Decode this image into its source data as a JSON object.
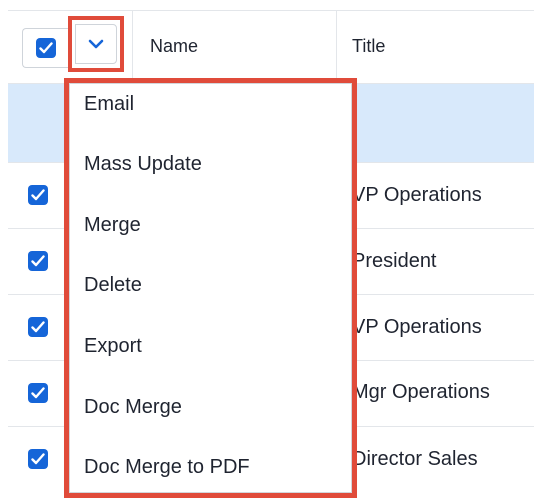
{
  "header": {
    "name_label": "Name",
    "title_label": "Title"
  },
  "icons": {
    "select_all_checkbox": "checkmark-icon",
    "actions_dropdown": "chevron-down-icon"
  },
  "colors": {
    "accent": "#1565d8",
    "annotation": "#e04b3a",
    "selected_row": "#d8e9fb"
  },
  "rows": [
    {
      "title": "",
      "checked": false,
      "highlighted": true
    },
    {
      "title": "VP Operations",
      "checked": true
    },
    {
      "title": "President",
      "checked": true
    },
    {
      "title": "VP Operations",
      "checked": true
    },
    {
      "title": "Mgr Operations",
      "checked": true
    },
    {
      "title": "Director Sales",
      "checked": true
    }
  ],
  "menu": {
    "items": [
      "Email",
      "Mass Update",
      "Merge",
      "Delete",
      "Export",
      "Doc Merge",
      "Doc Merge to PDF"
    ]
  }
}
